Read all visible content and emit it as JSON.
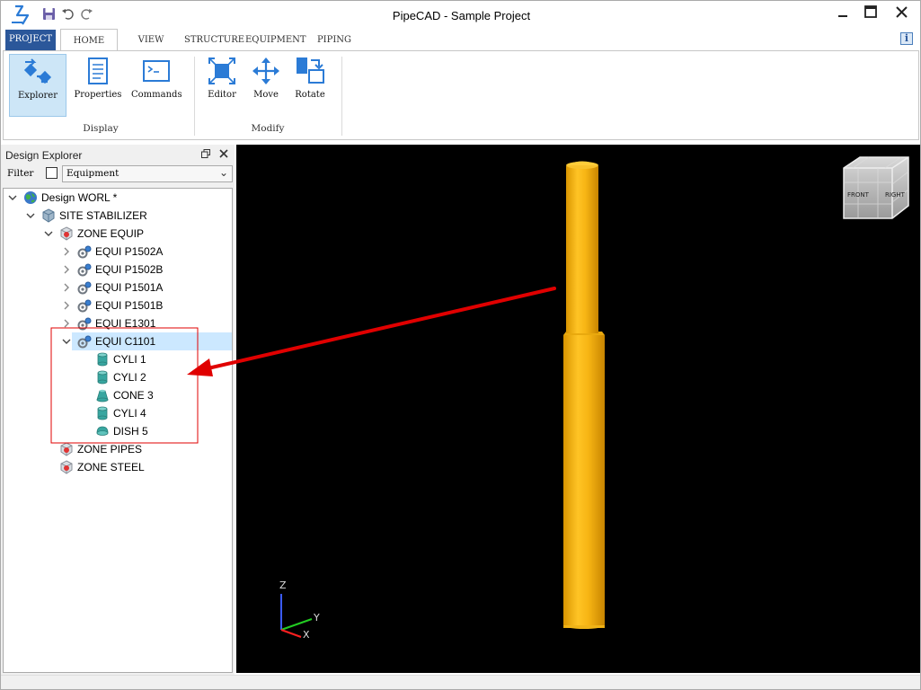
{
  "window": {
    "title": "PipeCAD - Sample Project",
    "controls": [
      "minimize",
      "maximize",
      "close"
    ]
  },
  "ribbon": {
    "tabs": [
      {
        "id": "project",
        "label": "PROJECT"
      },
      {
        "id": "home",
        "label": "HOME",
        "active": true
      },
      {
        "id": "view",
        "label": "VIEW"
      },
      {
        "id": "structure",
        "label": "STRUCTURE"
      },
      {
        "id": "equipment",
        "label": "EQUIPMENT"
      },
      {
        "id": "piping",
        "label": "PIPING"
      }
    ],
    "groups": [
      {
        "label": "Display",
        "buttons": [
          {
            "label": "Explorer",
            "icon": "explorer-icon",
            "selected": true
          },
          {
            "label": "Properties",
            "icon": "properties-icon"
          },
          {
            "label": "Commands",
            "icon": "commands-icon"
          }
        ]
      },
      {
        "label": "Modify",
        "buttons": [
          {
            "label": "Editor",
            "icon": "editor-icon"
          },
          {
            "label": "Move",
            "icon": "move-icon"
          },
          {
            "label": "Rotate",
            "icon": "rotate-icon"
          }
        ]
      }
    ]
  },
  "explorer": {
    "title": "Design Explorer",
    "filter_label": "Filter",
    "filter_checked": false,
    "filter_value": "Equipment",
    "tree": [
      {
        "label": "Design WORL *",
        "icon": "globe-icon",
        "expanded": true
      },
      {
        "label": "SITE STABILIZER",
        "icon": "site-icon",
        "expanded": true
      },
      {
        "label": "ZONE EQUIP",
        "icon": "zone-icon",
        "expanded": true
      },
      {
        "label": "EQUI P1502A",
        "icon": "equipment-icon",
        "expanded": false
      },
      {
        "label": "EQUI P1502B",
        "icon": "equipment-icon",
        "expanded": false
      },
      {
        "label": "EQUI P1501A",
        "icon": "equipment-icon",
        "expanded": false
      },
      {
        "label": "EQUI P1501B",
        "icon": "equipment-icon",
        "expanded": false
      },
      {
        "label": "EQUI E1301",
        "icon": "equipment-icon",
        "expanded": false
      },
      {
        "label": "EQUI C1101",
        "icon": "equipment-icon",
        "expanded": true,
        "selected": true
      },
      {
        "label": "CYLI 1",
        "icon": "cylinder-icon"
      },
      {
        "label": "CYLI 2",
        "icon": "cylinder-icon"
      },
      {
        "label": "CONE 3",
        "icon": "cone-icon"
      },
      {
        "label": "CYLI 4",
        "icon": "cylinder-icon"
      },
      {
        "label": "DISH 5",
        "icon": "dish-icon"
      },
      {
        "label": "ZONE PIPES",
        "icon": "zone-icon"
      },
      {
        "label": "ZONE STEEL",
        "icon": "zone-icon"
      }
    ]
  },
  "viewport": {
    "background": "#000000",
    "model_color": "#f5b416",
    "view_cube": {
      "front": "FRONT",
      "right": "RIGHT"
    },
    "axes": {
      "z": "Z",
      "y": "Y",
      "x": "X"
    },
    "highlight_color": "#e00000"
  }
}
